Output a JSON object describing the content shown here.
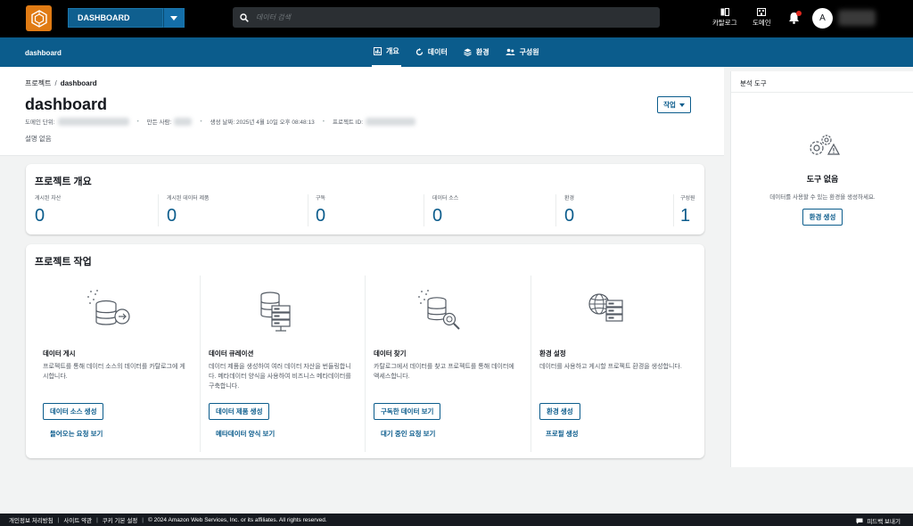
{
  "topbar": {
    "project_name": "DASHBOARD",
    "search_placeholder": "데이터 검색",
    "catalog_label": "카탈로그",
    "domain_label": "도메인",
    "avatar_initial": "A"
  },
  "navbar": {
    "project_slug": "dashboard",
    "tabs": [
      {
        "label": "개요",
        "active": true
      },
      {
        "label": "데이터"
      },
      {
        "label": "환경"
      },
      {
        "label": "구성원"
      }
    ]
  },
  "header": {
    "breadcrumb_root": "프로젝트",
    "breadcrumb_sep": "/",
    "breadcrumb_current": "dashboard",
    "title": "dashboard",
    "meta_domain_unit": "도메인 단위:",
    "meta_created_by": "만든 사람:",
    "meta_created_date": "생성 날짜: 2025년 4월 10일 오후 08:48:13",
    "meta_project_id": "프로젝트 ID:",
    "description": "설명 없음",
    "action_button": "작업"
  },
  "overview": {
    "title": "프로젝트 개요",
    "stats": [
      {
        "label": "게시된 자산",
        "value": "0"
      },
      {
        "label": "게시된 데이터 제품",
        "value": "0"
      },
      {
        "label": "구독",
        "value": "0"
      },
      {
        "label": "데이터 소스",
        "value": "0"
      },
      {
        "label": "환경",
        "value": "0"
      },
      {
        "label": "구성원",
        "value": "1"
      }
    ]
  },
  "actions": {
    "title": "프로젝트 작업",
    "items": [
      {
        "title": "데이터 게시",
        "desc": "프로젝트를 통해 데이터 소스의 데이터를 카탈로그에 게시합니다.",
        "button": "데이터 소스 생성",
        "link": "들어오는 요청 보기"
      },
      {
        "title": "데이터 큐레이션",
        "desc": "데이터 제품을 생성하여 여러 데이터 자산을 번들링합니다. 메타데이터 양식을 사용하여 비즈니스 메타데이터를 구축합니다.",
        "button": "데이터 제품 생성",
        "link": "메타데이터 양식 보기"
      },
      {
        "title": "데이터 찾기",
        "desc": "카탈로그에서 데이터를 찾고 프로젝트를 통해 데이터에 액세스합니다.",
        "button": "구독한 데이터 보기",
        "link": "대기 중인 요청 보기"
      },
      {
        "title": "환경 설정",
        "desc": "데이터를 사용하고 게시할 프로젝트 환경을 생성합니다.",
        "button": "환경 생성",
        "link": "프로필 생성"
      }
    ]
  },
  "side_panel": {
    "title": "분석 도구",
    "empty_heading": "도구 없음",
    "empty_text": "데이터를 사용할 수 있는 환경을 생성하세요.",
    "button": "환경 생성"
  },
  "footer": {
    "privacy": "개인정보 처리방침",
    "terms": "사이트 약관",
    "cookies": "쿠키 기본 설정",
    "copyright": "© 2024 Amazon Web Services, Inc. or its affiliates. All rights reserved.",
    "feedback": "피드백 보내기"
  },
  "colors": {
    "accent": "#0b5c8c",
    "topbar": "#000000",
    "logo": "#e07b14"
  }
}
